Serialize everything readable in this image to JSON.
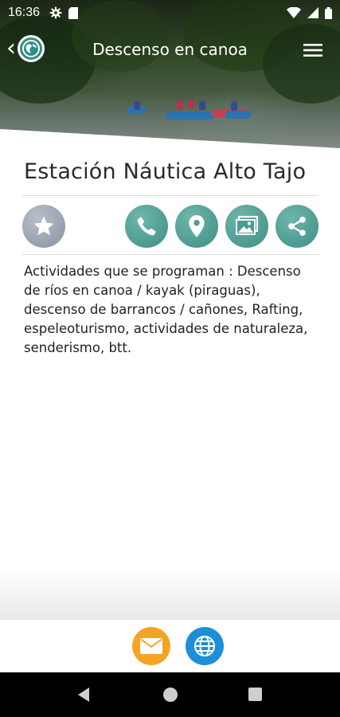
{
  "status_bar": {
    "time": "16:36",
    "left_icons": [
      "gear-icon",
      "sd-card-icon"
    ],
    "right_icons": [
      "wifi-icon",
      "signal-icon",
      "battery-icon"
    ]
  },
  "app_bar": {
    "title": "Descenso en canoa",
    "back_icon": "chevron-left-icon",
    "logo_icon": "globe-icon",
    "menu_icon": "hamburger-menu-icon"
  },
  "place": {
    "name": "Estación Náutica Alto Tajo",
    "description": "Actividades que se programan : Descenso de ríos en canoa / kayak (piraguas), descenso de barrancos / cañones, Rafting, espeleoturismo, actividades de naturaleza, senderismo, btt."
  },
  "actions": [
    {
      "name": "favorite",
      "icon": "star-icon",
      "color": "#9aa2af"
    },
    {
      "name": "call",
      "icon": "phone-icon",
      "color": "#4a9e93"
    },
    {
      "name": "location",
      "icon": "map-pin-icon",
      "color": "#4a9e93"
    },
    {
      "name": "gallery",
      "icon": "image-icon",
      "color": "#4a9e93"
    },
    {
      "name": "share",
      "icon": "share-icon",
      "color": "#4a9e93"
    }
  ],
  "footer": {
    "email": {
      "icon": "envelope-icon",
      "color": "#f4a424"
    },
    "website": {
      "icon": "globe-icon",
      "color": "#1e8fd6"
    }
  },
  "navigation_bar": [
    "back-triangle-icon",
    "home-circle-icon",
    "recents-square-icon"
  ]
}
